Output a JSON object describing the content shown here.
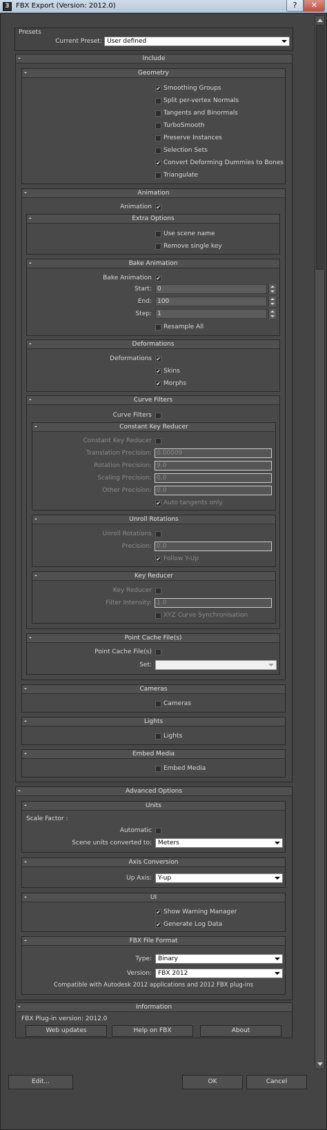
{
  "window": {
    "title": "FBX Export (Version: 2012.0)",
    "help_glyph": "?",
    "close_glyph": "✕",
    "app_icon": "3"
  },
  "glyphs": {
    "minus": "-",
    "check": "✔"
  },
  "presets": {
    "title": "Presets",
    "current_label": "Current Preset:",
    "current_value": "User defined"
  },
  "include": {
    "title": "Include",
    "geometry": {
      "title": "Geometry",
      "items": [
        {
          "label": "Smoothing Groups",
          "checked": true
        },
        {
          "label": "Split per-vertex Normals",
          "checked": false
        },
        {
          "label": "Tangents and Binormals",
          "checked": false
        },
        {
          "label": "TurboSmooth",
          "checked": false
        },
        {
          "label": "Preserve Instances",
          "checked": false
        },
        {
          "label": "Selection Sets",
          "checked": false
        },
        {
          "label": "Convert Deforming Dummies to Bones",
          "checked": true
        },
        {
          "label": "Triangulate",
          "checked": false
        }
      ]
    },
    "animation": {
      "title": "Animation",
      "label": "Animation",
      "checked": true,
      "extra_options": {
        "title": "Extra Options",
        "use_scene_name": "Use scene name",
        "remove_single_key": "Remove single key"
      },
      "bake": {
        "title": "Bake Animation",
        "label": "Bake Animation",
        "checked": true,
        "start_label": "Start:",
        "start": "0",
        "end_label": "End:",
        "end": "100",
        "step_label": "Step:",
        "step": "1",
        "resample_all": "Resample All"
      },
      "deformations": {
        "title": "Deformations",
        "label": "Deformations",
        "checked": true,
        "skins": "Skins",
        "skins_checked": true,
        "morphs": "Morphs",
        "morphs_checked": true
      },
      "curve_filters": {
        "title": "Curve Filters",
        "label": "Curve Filters",
        "checked": false,
        "constant_key_reducer": {
          "title": "Constant Key Reducer",
          "label": "Constant Key Reducer",
          "translation_label": "Translation Precision:",
          "translation": "0.00009",
          "rotation_label": "Rotation Precision:",
          "rotation": "9.0",
          "scaling_label": "Scaling Precision:",
          "scaling": "0.0",
          "other_label": "Other Precision:",
          "other": "0.0",
          "auto_tangents": "Auto tangents only",
          "auto_tangents_checked": true
        },
        "unroll_rotations": {
          "title": "Unroll Rotations",
          "label": "Unroll Rotations",
          "precision_label": "Precision:",
          "precision": "0.0",
          "follow_yup": "Follow Y-Up",
          "follow_yup_checked": true
        },
        "key_reducer": {
          "title": "Key Reducer",
          "label": "Key Reducer",
          "filter_label": "Filter Intensity:",
          "filter": "1.0",
          "xyz_sync": "XYZ Curve Synchronisation"
        }
      },
      "point_cache": {
        "title": "Point Cache File(s)",
        "label": "Point Cache File(s)",
        "set_label": "Set:",
        "set_value": ""
      }
    },
    "cameras": {
      "title": "Cameras",
      "label": "Cameras"
    },
    "lights": {
      "title": "Lights",
      "label": "Lights"
    },
    "embed_media": {
      "title": "Embed Media",
      "label": "Embed Media"
    }
  },
  "advanced": {
    "title": "Advanced Options",
    "units": {
      "title": "Units",
      "scale_factor": "Scale Factor :",
      "automatic": "Automatic",
      "converted_label": "Scene units converted to:",
      "converted_value": "Meters"
    },
    "axis": {
      "title": "Axis Conversion",
      "up_label": "Up Axis:",
      "up_value": "Y-up"
    },
    "ui": {
      "title": "UI",
      "warning": "Show Warning Manager",
      "log": "Generate Log Data"
    },
    "format": {
      "title": "FBX File Format",
      "type_label": "Type:",
      "type_value": "Binary",
      "version_label": "Version:",
      "version_value": "FBX 2012",
      "compat": "Compatible with Autodesk 2012 applications and 2012 FBX plug-ins"
    }
  },
  "information": {
    "title": "Information",
    "plugin_version": "FBX Plug-in version: 2012.0",
    "web_updates": "Web updates",
    "help": "Help on FBX",
    "about": "About"
  },
  "footer": {
    "edit": "Edit...",
    "ok": "OK",
    "cancel": "Cancel"
  }
}
